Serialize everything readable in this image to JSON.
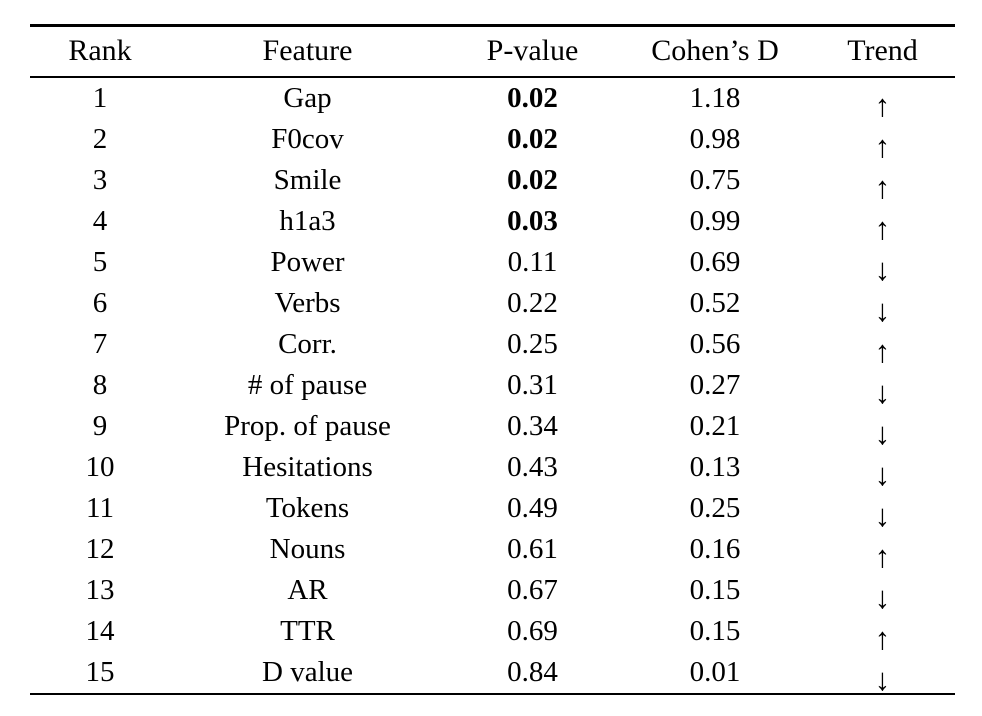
{
  "table": {
    "columns": [
      {
        "key": "rank",
        "label": "Rank"
      },
      {
        "key": "feature",
        "label": "Feature"
      },
      {
        "key": "pvalue",
        "label": "P-value"
      },
      {
        "key": "cohens_d",
        "label": "Cohen’s D"
      },
      {
        "key": "trend",
        "label": "Trend"
      }
    ],
    "rows": [
      {
        "rank": "1",
        "feature": "Gap",
        "pvalue": "0.02",
        "pvalue_bold": true,
        "cohens_d": "1.18",
        "trend": "↑",
        "trend_name": "up-arrow-icon"
      },
      {
        "rank": "2",
        "feature": "F0cov",
        "pvalue": "0.02",
        "pvalue_bold": true,
        "cohens_d": "0.98",
        "trend": "↑",
        "trend_name": "up-arrow-icon"
      },
      {
        "rank": "3",
        "feature": "Smile",
        "pvalue": "0.02",
        "pvalue_bold": true,
        "cohens_d": "0.75",
        "trend": "↑",
        "trend_name": "up-arrow-icon"
      },
      {
        "rank": "4",
        "feature": "h1a3",
        "pvalue": "0.03",
        "pvalue_bold": true,
        "cohens_d": "0.99",
        "trend": "↑",
        "trend_name": "up-arrow-icon"
      },
      {
        "rank": "5",
        "feature": "Power",
        "pvalue": "0.11",
        "pvalue_bold": false,
        "cohens_d": "0.69",
        "trend": "↓",
        "trend_name": "down-arrow-icon"
      },
      {
        "rank": "6",
        "feature": "Verbs",
        "pvalue": "0.22",
        "pvalue_bold": false,
        "cohens_d": "0.52",
        "trend": "↓",
        "trend_name": "down-arrow-icon"
      },
      {
        "rank": "7",
        "feature": "Corr.",
        "pvalue": "0.25",
        "pvalue_bold": false,
        "cohens_d": "0.56",
        "trend": "↑",
        "trend_name": "up-arrow-icon"
      },
      {
        "rank": "8",
        "feature": "# of pause",
        "pvalue": "0.31",
        "pvalue_bold": false,
        "cohens_d": "0.27",
        "trend": "↓",
        "trend_name": "down-arrow-icon"
      },
      {
        "rank": "9",
        "feature": "Prop. of pause",
        "pvalue": "0.34",
        "pvalue_bold": false,
        "cohens_d": "0.21",
        "trend": "↓",
        "trend_name": "down-arrow-icon"
      },
      {
        "rank": "10",
        "feature": "Hesitations",
        "pvalue": "0.43",
        "pvalue_bold": false,
        "cohens_d": "0.13",
        "trend": "↓",
        "trend_name": "down-arrow-icon"
      },
      {
        "rank": "11",
        "feature": "Tokens",
        "pvalue": "0.49",
        "pvalue_bold": false,
        "cohens_d": "0.25",
        "trend": "↓",
        "trend_name": "down-arrow-icon"
      },
      {
        "rank": "12",
        "feature": "Nouns",
        "pvalue": "0.61",
        "pvalue_bold": false,
        "cohens_d": "0.16",
        "trend": "↑",
        "trend_name": "up-arrow-icon"
      },
      {
        "rank": "13",
        "feature": "AR",
        "pvalue": "0.67",
        "pvalue_bold": false,
        "cohens_d": "0.15",
        "trend": "↓",
        "trend_name": "down-arrow-icon"
      },
      {
        "rank": "14",
        "feature": "TTR",
        "pvalue": "0.69",
        "pvalue_bold": false,
        "cohens_d": "0.15",
        "trend": "↑",
        "trend_name": "up-arrow-icon"
      },
      {
        "rank": "15",
        "feature": "D value",
        "pvalue": "0.84",
        "pvalue_bold": false,
        "cohens_d": "0.01",
        "trend": "↓",
        "trend_name": "down-arrow-icon"
      }
    ]
  }
}
